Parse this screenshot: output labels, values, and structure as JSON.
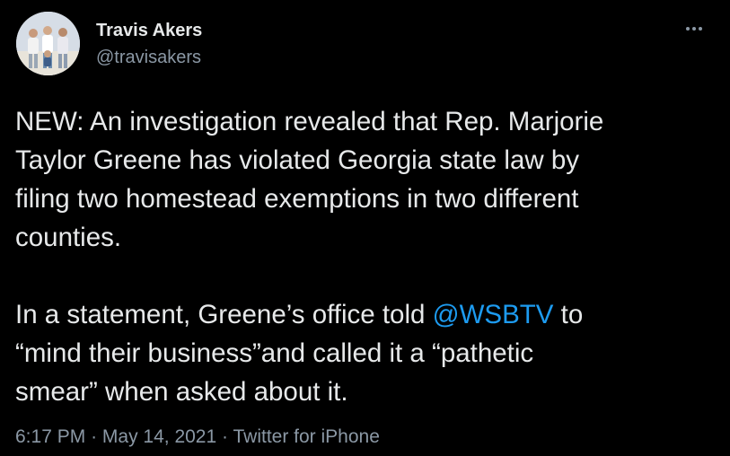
{
  "author": {
    "name": "Travis Akers",
    "handle": "@travisakers",
    "avatar_icon": "family-photo-avatar"
  },
  "more_icon": "ellipsis-icon",
  "tweet": {
    "paragraph1": [
      "NEW: An investigation revealed that Rep. Marjorie",
      "Taylor Greene has violated Georgia state law by",
      "filing two homestead exemptions in two different",
      "counties."
    ],
    "paragraph2": {
      "line1_before": "In a statement, Greene’s office told ",
      "mention": "@WSBTV",
      "line1_after": " to",
      "line2": "“mind their business”and called it a “pathetic",
      "line3": "smear” when asked about it."
    }
  },
  "meta": {
    "time": "6:17 PM",
    "separator": "·",
    "date": "May 14, 2021",
    "source": "Twitter for iPhone"
  },
  "colors": {
    "background": "#000000",
    "text": "#e7e9ea",
    "secondary": "#8b98a5",
    "link": "#1d9bf0"
  }
}
